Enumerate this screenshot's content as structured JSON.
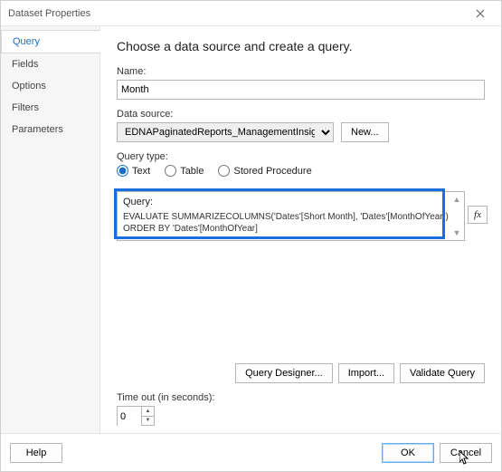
{
  "window": {
    "title": "Dataset Properties"
  },
  "sidebar": {
    "items": [
      {
        "label": "Query",
        "active": true
      },
      {
        "label": "Fields"
      },
      {
        "label": "Options"
      },
      {
        "label": "Filters"
      },
      {
        "label": "Parameters"
      }
    ]
  },
  "main": {
    "heading": "Choose a data source and create a query.",
    "name_label": "Name:",
    "name_value": "Month",
    "datasource_label": "Data source:",
    "datasource_value": "EDNAPaginatedReports_ManagementInsights",
    "new_button": "New...",
    "querytype_label": "Query type:",
    "querytype_options": [
      "Text",
      "Table",
      "Stored Procedure"
    ],
    "querytype_selected": "Text",
    "query_label": "Query:",
    "query_text": "EVALUATE SUMMARIZECOLUMNS('Dates'[Short Month], 'Dates'[MonthOfYear]) ORDER BY 'Dates'[MonthOfYear]",
    "fx_label": "fx",
    "query_designer_button": "Query Designer...",
    "import_button": "Import...",
    "validate_button": "Validate Query",
    "timeout_label": "Time out (in seconds):",
    "timeout_value": "0"
  },
  "footer": {
    "help": "Help",
    "ok": "OK",
    "cancel": "Cancel"
  }
}
